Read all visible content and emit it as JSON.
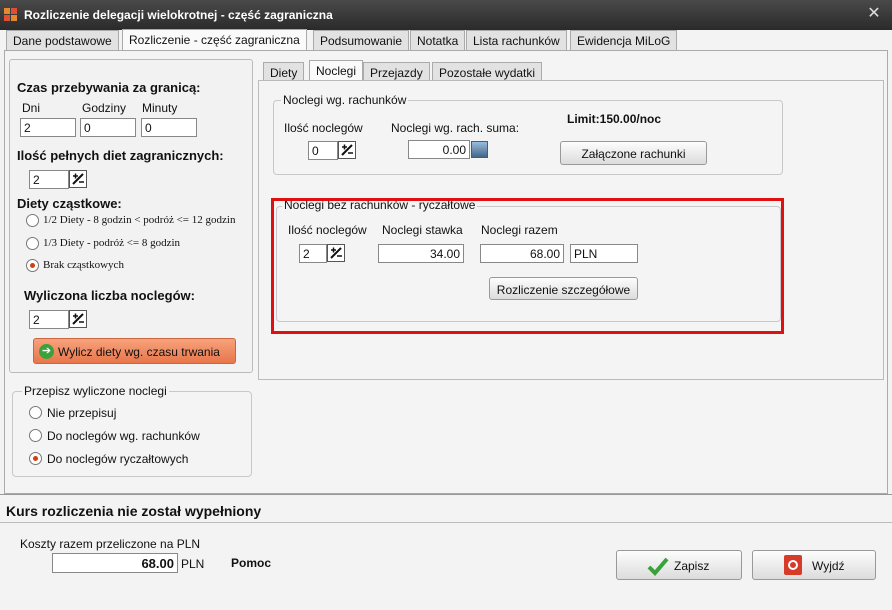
{
  "window": {
    "title": "Rozliczenie delegacji wielokrotnej - część zagraniczna"
  },
  "main_tabs": [
    {
      "label": "Dane podstawowe"
    },
    {
      "label": "Rozliczenie - część zagraniczna"
    },
    {
      "label": "Podsumowanie"
    },
    {
      "label": "Notatka"
    },
    {
      "label": "Lista rachunków"
    },
    {
      "label": "Ewidencja MiLoG"
    }
  ],
  "left": {
    "time_abroad_label": "Czas przebywania za granicą:",
    "days_label": "Dni",
    "hours_label": "Godziny",
    "minutes_label": "Minuty",
    "days_value": "2",
    "hours_value": "0",
    "minutes_value": "0",
    "full_diets_label": "Ilość pełnych diet zagranicznych:",
    "full_diets_value": "2",
    "partial_diets_label": "Diety cząstkowe:",
    "partial_options": [
      "1/2 Diety - 8 godzin < podróż <= 12 godzin",
      "1/3 Diety - podróż <= 8 godzin",
      "Brak cząstkowych"
    ],
    "nights_calc_label": "Wyliczona liczba noclegów:",
    "nights_calc_value": "2",
    "calc_button": "Wylicz diety wg. czasu trwania",
    "rewrite_group": "Przepisz wyliczone noclegi",
    "rewrite_options": [
      "Nie przepisuj",
      "Do noclegów wg. rachunków",
      "Do noclegów ryczałtowych"
    ]
  },
  "sub_tabs": [
    {
      "label": "Diety"
    },
    {
      "label": "Noclegi"
    },
    {
      "label": "Przejazdy"
    },
    {
      "label": "Pozostałe wydatki"
    }
  ],
  "receipts": {
    "group_label": "Noclegi wg. rachunków",
    "count_label": "Ilość noclegów",
    "count_value": "0",
    "sum_label": "Noclegi wg. rach. suma:",
    "sum_value": "0.00",
    "limit": "Limit:150.00/noc",
    "attached_button": "Załączone rachunki"
  },
  "flat": {
    "group_label": "Noclegi bez rachunków - ryczałtowe",
    "count_label": "Ilość noclegów",
    "count_value": "2",
    "rate_label": "Noclegi stawka",
    "rate_value": "34.00",
    "total_label": "Noclegi razem",
    "total_value": "68.00",
    "currency": "PLN",
    "detail_button": "Rozliczenie szczegółowe"
  },
  "bottom": {
    "rate_message": "Kurs rozliczenia nie został wypełniony",
    "cost_label": "Koszty razem przeliczone na PLN",
    "cost_value": "68.00",
    "cost_currency": "PLN",
    "help_label": "Pomoc",
    "save_button": "Zapisz",
    "exit_button": "Wyjdź"
  },
  "colors": {
    "highlight": "#e01010",
    "calc_button": "#f08a5d",
    "radio_on": "#d04010"
  }
}
